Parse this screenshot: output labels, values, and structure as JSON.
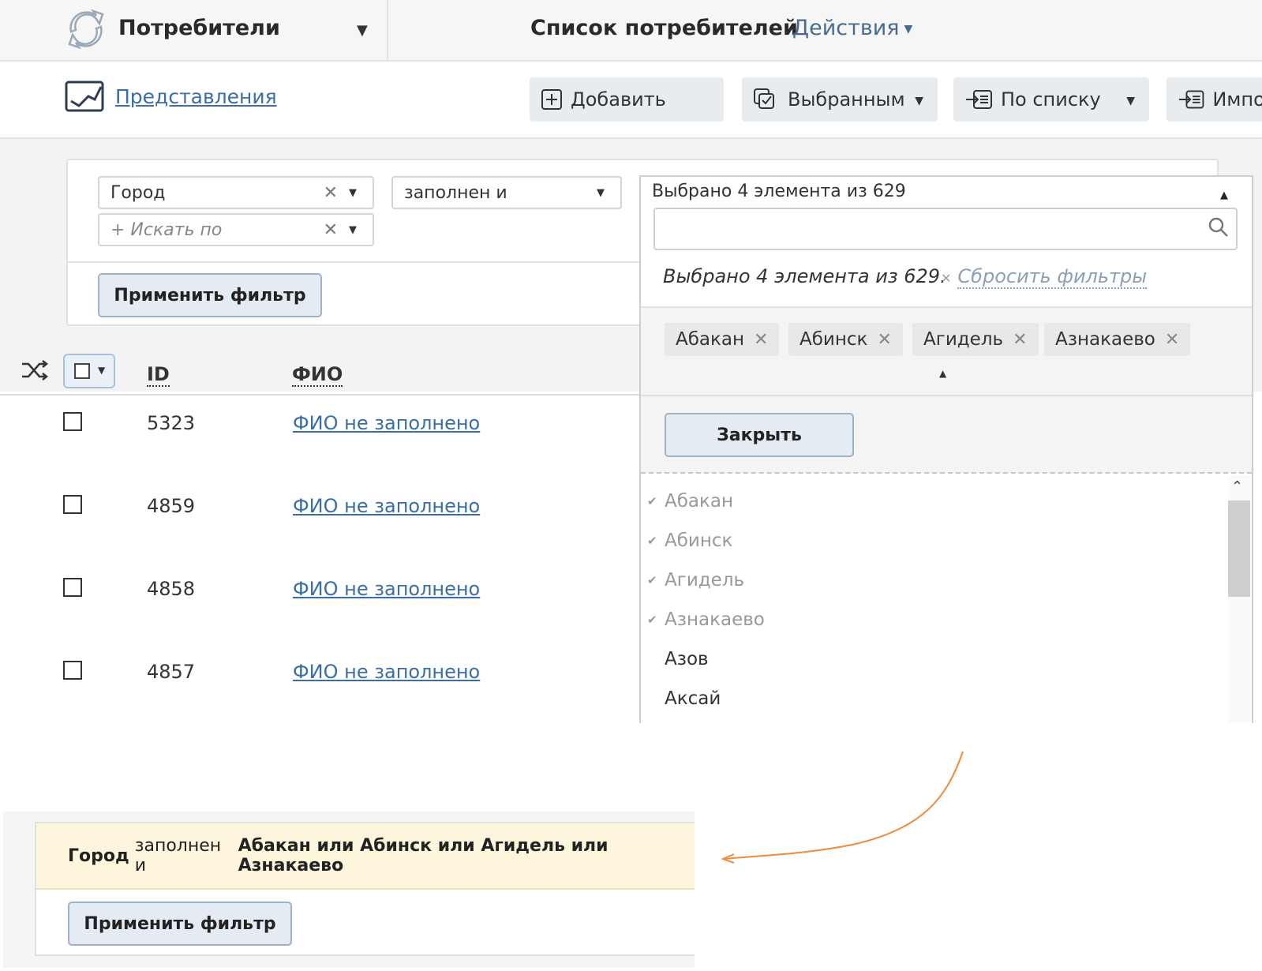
{
  "header": {
    "app_title": "Потребители",
    "page_title": "Список потребителей",
    "actions_label": "Действия"
  },
  "toolbar": {
    "views_label": "Представления",
    "add_label": "Добавить",
    "selected_label": "Выбранным",
    "by_list_label": "По списку",
    "import_label": "Импор"
  },
  "filter": {
    "field_value": "Город",
    "search_placeholder": "+ Искать по",
    "condition_value": "заполнен и",
    "apply_label": "Применить фильтр"
  },
  "dropdown": {
    "header_text": "Выбрано 4 элемента из 629",
    "status_text": "Выбрано 4 элемента из 629.",
    "reset_label": "Сбросить фильтры",
    "tags": [
      "Абакан",
      "Абинск",
      "Агидель",
      "Азнакаево"
    ],
    "close_label": "Закрыть",
    "options": [
      {
        "label": "Абакан",
        "selected": true
      },
      {
        "label": "Абинск",
        "selected": true
      },
      {
        "label": "Агидель",
        "selected": true
      },
      {
        "label": "Азнакаево",
        "selected": true
      },
      {
        "label": "Азов",
        "selected": false
      },
      {
        "label": "Аксай",
        "selected": false
      }
    ]
  },
  "table": {
    "col_id": "ID",
    "col_fio": "ФИО",
    "rows": [
      {
        "id": "5323",
        "fio": "ФИО не заполнено"
      },
      {
        "id": "4859",
        "fio": "ФИО не заполнено"
      },
      {
        "id": "4858",
        "fio": "ФИО не заполнено"
      },
      {
        "id": "4857",
        "fio": "ФИО не заполнено"
      }
    ]
  },
  "summary": {
    "field": "Город",
    "condition": "заполнен и",
    "values": "Абакан или Абинск или Агидель или Азнакаево",
    "apply_label": "Применить фильтр"
  },
  "colors": {
    "link": "#3a6ea5",
    "summary_bg": "#fdf6dc",
    "arrow": "#f08a3c"
  }
}
